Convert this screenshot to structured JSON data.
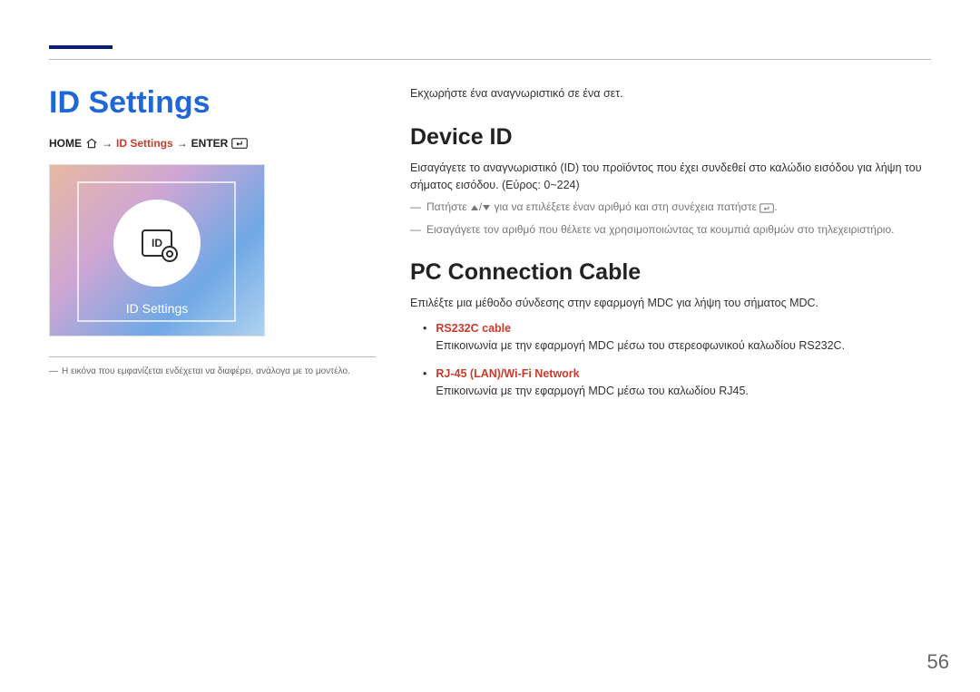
{
  "title": "ID Settings",
  "breadcrumb": {
    "home": "HOME",
    "arrow": "→",
    "mid": "ID Settings",
    "enter": "ENTER"
  },
  "thumbnail": {
    "id_label": "ID",
    "caption": "ID Settings"
  },
  "image_note_prefix": "―",
  "image_note": "Η εικόνα που εμφανίζεται ενδέχεται να διαφέρει, ανάλογα με το μοντέλο.",
  "intro_line": "Εκχωρήστε ένα αναγνωριστικό σε ένα σετ.",
  "sections": {
    "device_id": {
      "heading": "Device ID",
      "body_line1": "Εισαγάγετε το αναγνωριστικό (ID) του προϊόντος που έχει συνδεθεί στο καλώδιο εισόδου για λήψη του σήματος εισόδου. (Εύρος: 0~224)",
      "note1_pre": "Πατήστε ",
      "note1_mid": "/",
      "note1_post": " για να επιλέξετε έναν αριθμό και στη συνέχεια πατήστε ",
      "note1_end": ".",
      "note2": "Εισαγάγετε τον αριθμό που θέλετε να χρησιμοποιώντας τα κουμπιά αριθμών στο τηλεχειριστήριο."
    },
    "pc_cable": {
      "heading": "PC Connection Cable",
      "body": "Επιλέξτε μια μέθοδο σύνδεσης στην εφαρμογή MDC για λήψη του σήματος MDC.",
      "items": [
        {
          "title": "RS232C cable",
          "desc": "Επικοινωνία με την εφαρμογή MDC μέσω του στερεοφωνικού καλωδίου RS232C."
        },
        {
          "title": "RJ-45 (LAN)/Wi-Fi Network",
          "desc": "Επικοινωνία με την εφαρμογή MDC μέσω του καλωδίου RJ45."
        }
      ]
    }
  },
  "page_number": "56"
}
